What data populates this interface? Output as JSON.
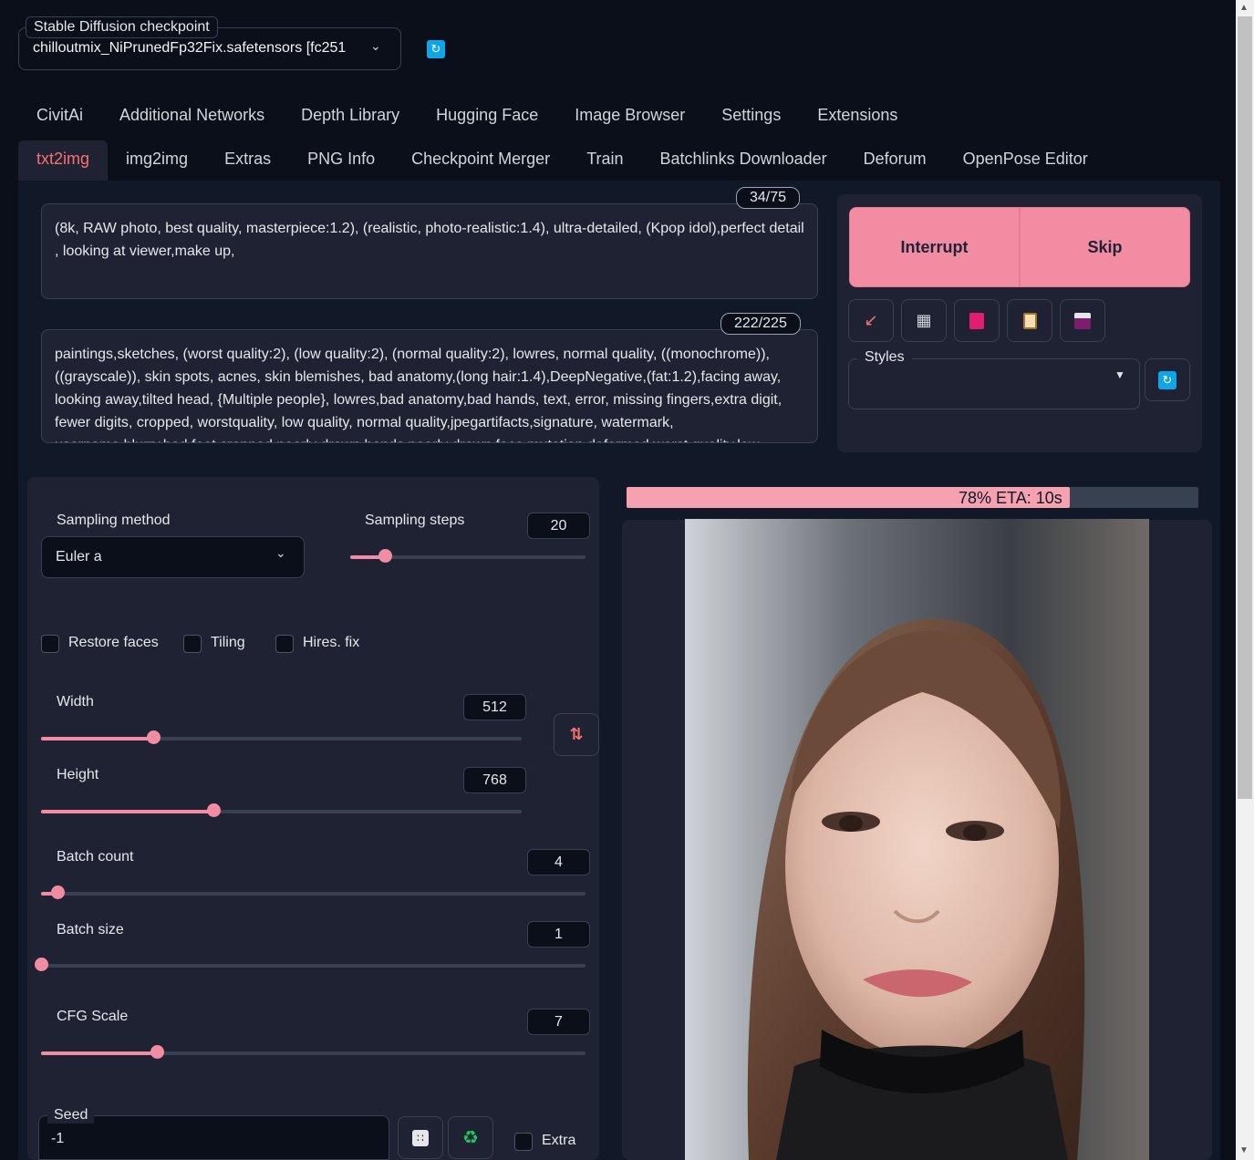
{
  "checkpoint": {
    "label": "Stable Diffusion checkpoint",
    "value": "chilloutmix_NiPrunedFp32Fix.safetensors [fc251"
  },
  "tabs_top": [
    "CivitAi",
    "Additional Networks",
    "Depth Library",
    "Hugging Face",
    "Image Browser",
    "Settings",
    "Extensions"
  ],
  "tabs_main": [
    "txt2img",
    "img2img",
    "Extras",
    "PNG Info",
    "Checkpoint Merger",
    "Train",
    "Batchlinks Downloader",
    "Deforum",
    "OpenPose Editor"
  ],
  "active_tab": "txt2img",
  "prompt": {
    "counter": "34/75",
    "text": "(8k, RAW photo, best quality, masterpiece:1.2), (realistic, photo-realistic:1.4), ultra-detailed, (Kpop idol),perfect detail ,  looking at viewer,make up,"
  },
  "negative_prompt": {
    "counter": "222/225",
    "text": "paintings,sketches, (worst quality:2), (low quality:2), (normal quality:2), lowres, normal quality, ((monochrome)), ((grayscale)), skin spots, acnes, skin blemishes, bad anatomy,(long hair:1.4),DeepNegative,(fat:1.2),facing away, looking away,tilted head, {Multiple people}, lowres,bad anatomy,bad hands, text, error, missing fingers,extra digit, fewer digits, cropped, worstquality, low quality, normal quality,jpegartifacts,signature, watermark, username,blurry,bad feet,cropped,poorly drawn hands,poorly drawn face,mutation,deformed,worst quality,low"
  },
  "actions": {
    "interrupt": "Interrupt",
    "skip": "Skip",
    "tools": [
      "arrow-icon",
      "trash-icon",
      "bookmark-icon",
      "clipboard-icon",
      "save-icon"
    ],
    "styles_label": "Styles"
  },
  "params": {
    "sampling_method_label": "Sampling method",
    "sampling_method_value": "Euler a",
    "sampling_steps_label": "Sampling steps",
    "sampling_steps": "20",
    "restore_faces": "Restore faces",
    "tiling": "Tiling",
    "hires_fix": "Hires. fix",
    "width_label": "Width",
    "width": "512",
    "height_label": "Height",
    "height": "768",
    "batch_count_label": "Batch count",
    "batch_count": "4",
    "batch_size_label": "Batch size",
    "batch_size": "1",
    "cfg_label": "CFG Scale",
    "cfg": "7",
    "seed_label": "Seed",
    "seed": "-1",
    "extra_label": "Extra"
  },
  "slider_levels": {
    "sampling_steps": 0.146,
    "width": 0.234,
    "height": 0.359,
    "batch_count": 0.03,
    "batch_size": 0.0,
    "cfg": 0.213
  },
  "progress": {
    "text": "78% ETA: 10s",
    "fraction": 0.78
  },
  "colors": {
    "accent": "#f28ca3",
    "background": "#0b0f19",
    "panel": "#1f2233",
    "active_tab": "#f87171"
  }
}
